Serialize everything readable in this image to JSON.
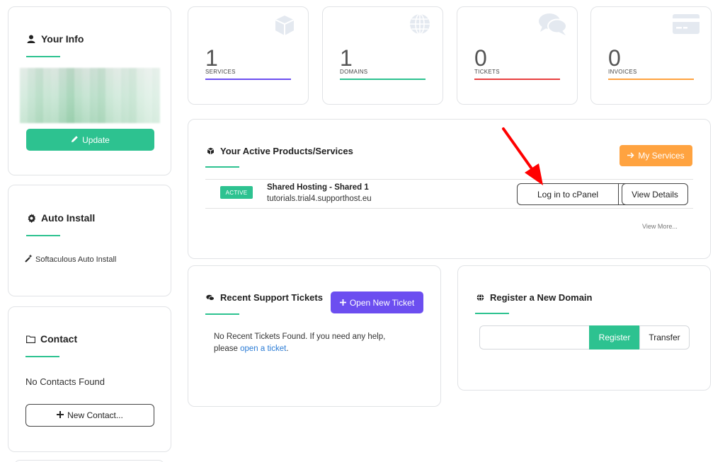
{
  "user_info": {
    "title": "Your Info",
    "update_label": "Update"
  },
  "auto_install": {
    "title": "Auto Install",
    "item": "Softaculous Auto Install"
  },
  "contact": {
    "title": "Contact",
    "empty_text": "No Contacts Found",
    "new_contact_label": "New Contact..."
  },
  "stats": [
    {
      "count": "1",
      "label": "SERVICES",
      "icon": "cube-icon",
      "bar_color": "#6c4ef0"
    },
    {
      "count": "1",
      "label": "DOMAINS",
      "icon": "globe-icon",
      "bar_color": "#2dc290"
    },
    {
      "count": "0",
      "label": "TICKETS",
      "icon": "comments-icon",
      "bar_color": "#e8403f"
    },
    {
      "count": "0",
      "label": "INVOICES",
      "icon": "credit-card-icon",
      "bar_color": "#ffa340"
    }
  ],
  "products": {
    "title": "Your Active Products/Services",
    "my_services_label": "My Services",
    "status": "ACTIVE",
    "product_name": "Shared Hosting - Shared 1",
    "domain": "tutorials.trial4.supporthost.eu",
    "cpanel_label": "Log in to cPanel",
    "view_details_label": "View Details",
    "view_more_label": "View More..."
  },
  "tickets": {
    "title": "Recent Support Tickets",
    "open_ticket_label": "Open New Ticket",
    "empty_text_line1": "No Recent Tickets Found. If you need any help,",
    "empty_text_prefix": "please",
    "empty_text_link": "open a ticket",
    "empty_text_suffix": "."
  },
  "domain": {
    "title": "Register a New Domain",
    "input_value": "",
    "register_label": "Register",
    "transfer_label": "Transfer"
  },
  "colors": {
    "accent_green": "#2dc290",
    "accent_purple": "#6c4ef0",
    "accent_orange": "#ffa340",
    "accent_red": "#e8403f",
    "annotation_arrow": "#ff0000"
  }
}
